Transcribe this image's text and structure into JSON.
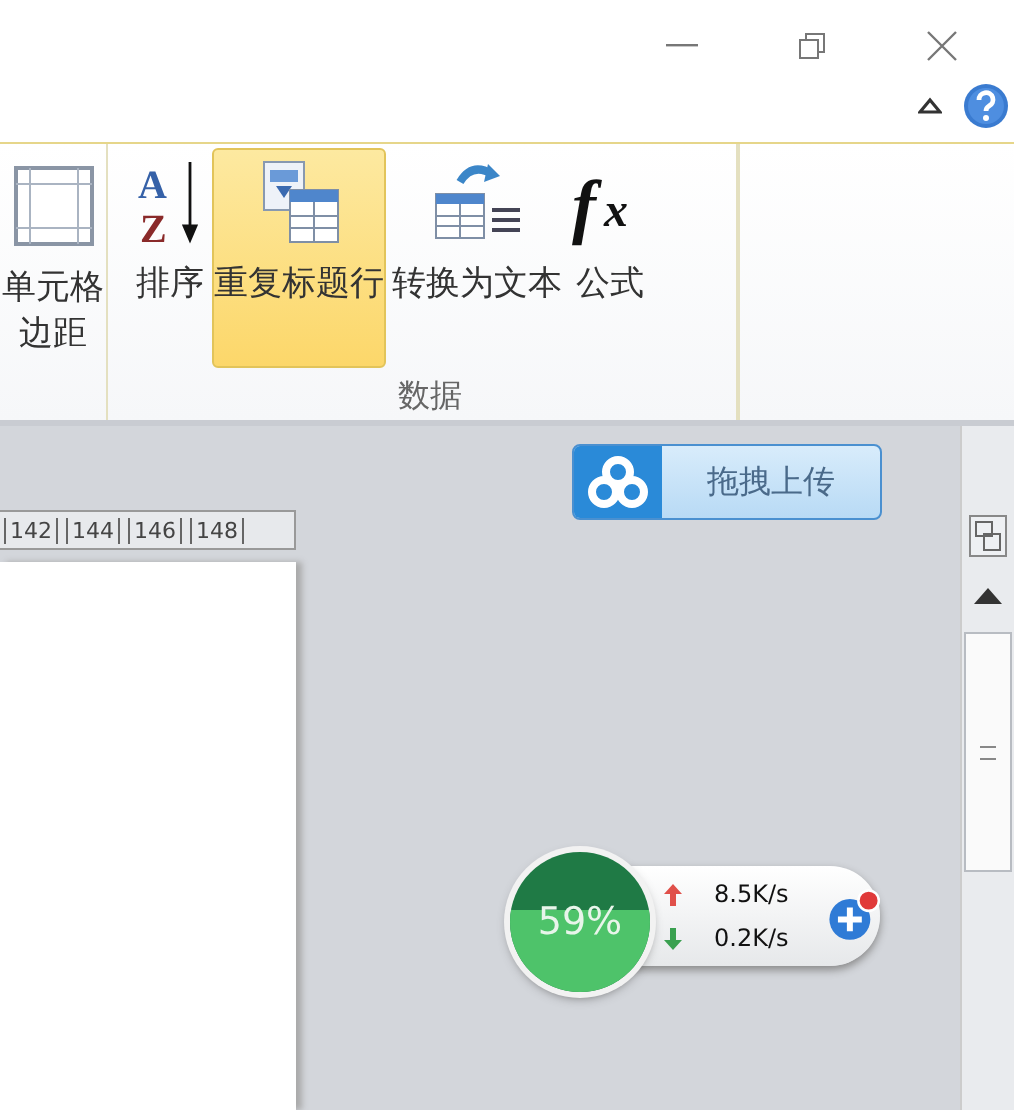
{
  "ribbon": {
    "partial_group": {
      "buttons": [
        {
          "kind": "cell-margins",
          "label_lines": [
            "单元格",
            "边距"
          ],
          "highlighted": false
        }
      ]
    },
    "data_group": {
      "label": "数据",
      "buttons": [
        {
          "kind": "sort",
          "icon_glyphs": [
            "A",
            "Z"
          ],
          "label_lines": [
            "排序"
          ],
          "highlighted": false
        },
        {
          "kind": "repeat-header",
          "label_lines": [
            "重复标题行"
          ],
          "highlighted": true
        },
        {
          "kind": "to-text",
          "label_lines": [
            "转换为文本"
          ],
          "highlighted": false
        },
        {
          "kind": "formula",
          "icon_glyphs": [
            "f",
            "x"
          ],
          "label_lines": [
            "公式"
          ],
          "highlighted": false
        }
      ]
    }
  },
  "upload_button": {
    "label": "拖拽上传"
  },
  "ruler": {
    "labels": [
      "142",
      "144",
      "146",
      "148"
    ]
  },
  "speed_widget": {
    "percent": "59%",
    "upload": "8.5K/s",
    "download": "0.2K/s"
  }
}
